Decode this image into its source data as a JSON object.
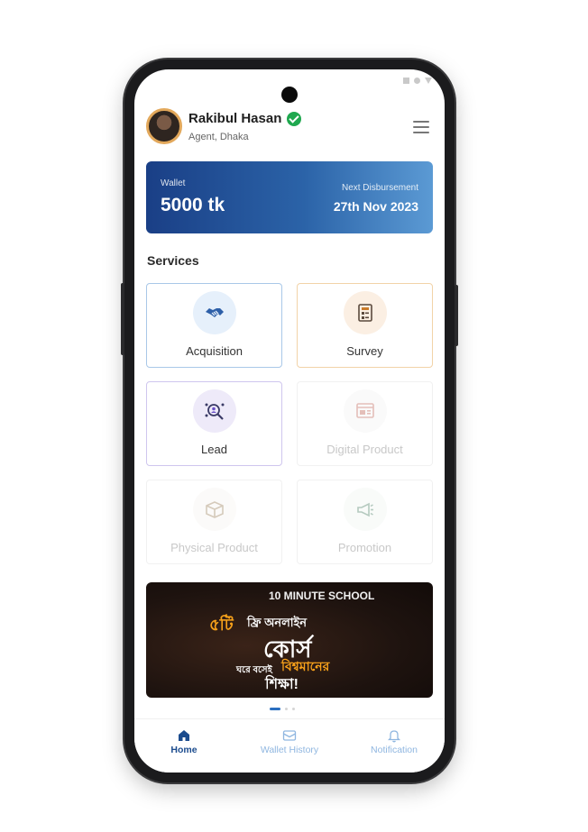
{
  "user": {
    "name": "Rakibul Hasan",
    "role": "Agent, Dhaka"
  },
  "wallet": {
    "label": "Wallet",
    "amount": "5000 tk",
    "next_label": "Next Disbursement",
    "next_date": "27th Nov 2023"
  },
  "services": {
    "title": "Services",
    "items": [
      {
        "label": "Acquisition",
        "icon": "handshake-icon",
        "enabled": true
      },
      {
        "label": "Survey",
        "icon": "survey-form-icon",
        "enabled": true
      },
      {
        "label": "Lead",
        "icon": "lead-search-icon",
        "enabled": true
      },
      {
        "label": "Digital Product",
        "icon": "browser-window-icon",
        "enabled": false
      },
      {
        "label": "Physical Product",
        "icon": "package-box-icon",
        "enabled": false
      },
      {
        "label": "Promotion",
        "icon": "megaphone-icon",
        "enabled": false
      }
    ]
  },
  "banner": {
    "brand": "10 MINUTE SCHOOL",
    "line1": "৫টি",
    "line2": "ফ্রি অনলাইন",
    "line3": "কোর্স",
    "line4": "ঘরে বসেই",
    "line5": "বিশ্বমানের",
    "line6": "শিক্ষা!"
  },
  "carousel": {
    "count": 3,
    "active": 0
  },
  "nav": {
    "items": [
      {
        "label": "Home",
        "icon": "home-icon",
        "active": true
      },
      {
        "label": "Wallet History",
        "icon": "wallet-history-icon",
        "active": false
      },
      {
        "label": "Notification",
        "icon": "bell-icon",
        "active": false
      }
    ]
  },
  "colors": {
    "primary": "#1c4c8e",
    "verified": "#1fa84f",
    "acquisition_border": "#a9c8e8",
    "survey_border": "#f2d3a8",
    "lead_border": "#cfc6ee",
    "banner_accent": "#f7a11a"
  }
}
